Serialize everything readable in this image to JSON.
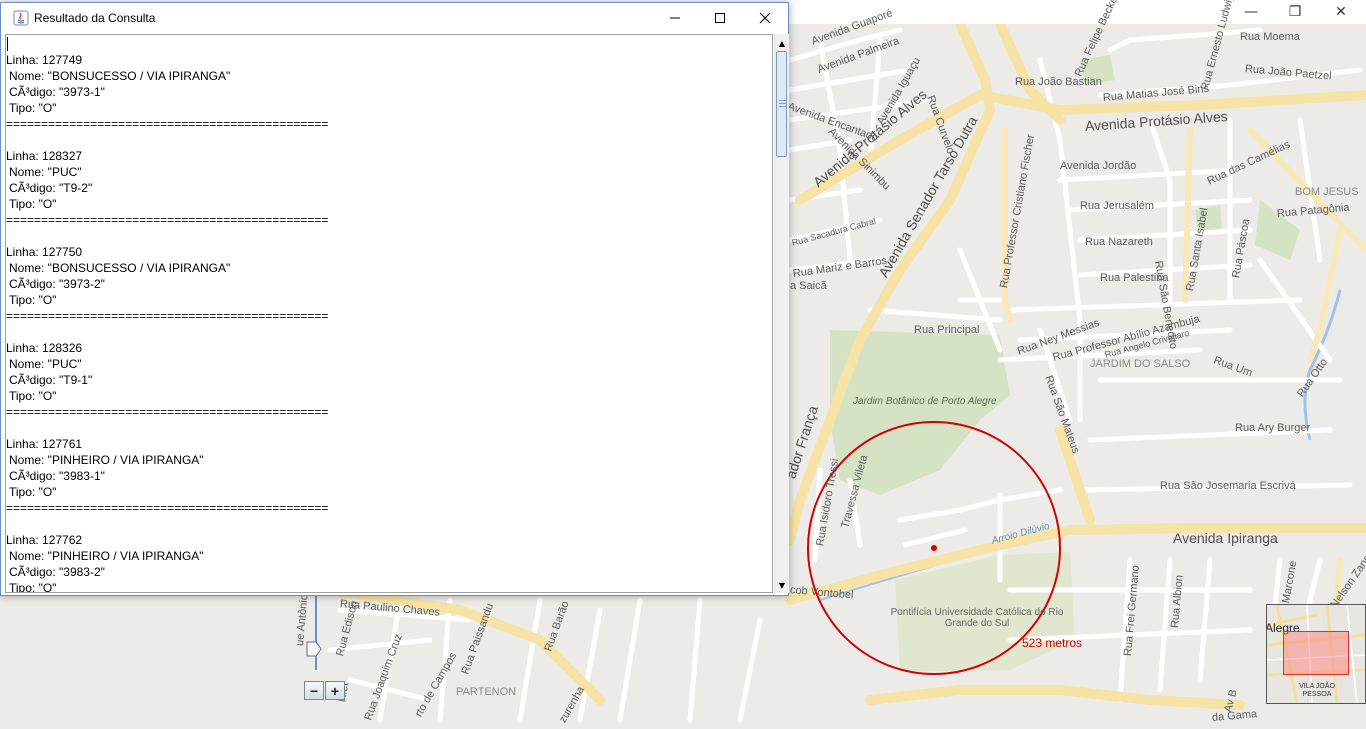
{
  "main_window": {
    "controls": {
      "minimize": "—",
      "restore": "❐",
      "close": "✕"
    }
  },
  "map": {
    "streets": [
      {
        "id": "av-guapore",
        "text": "Avenida Guaporé"
      },
      {
        "id": "av-palmeira",
        "text": "Avenida Palmeira"
      },
      {
        "id": "av-iguacu",
        "text": "Avenida Iguaçu"
      },
      {
        "id": "av-encantado",
        "text": "Avenida Encantado"
      },
      {
        "id": "av-sinimbu",
        "text": "Avenida Sinimbu"
      },
      {
        "id": "av-protasio-1",
        "text": "Avenida Protásio Alves"
      },
      {
        "id": "av-protasio-2",
        "text": "Avenida Protásio Alves"
      },
      {
        "id": "rua-curvelo",
        "text": "Rua Curvelo"
      },
      {
        "id": "av-tarso-dutra",
        "text": "Avenida Senador Tarso Dutra"
      },
      {
        "id": "rua-cristiano-fischer",
        "text": "Rua Professor Cristiano Fischer"
      },
      {
        "id": "rua-joao-bastian",
        "text": "Rua João Bastian"
      },
      {
        "id": "rua-felipe-becker",
        "text": "Rua Felipe Becker"
      },
      {
        "id": "rua-moema",
        "text": "Rua Moema"
      },
      {
        "id": "rua-joao-paetzel",
        "text": "Rua João Paetzel"
      },
      {
        "id": "rua-matias-jose-bins",
        "text": "Rua Matias José Bins"
      },
      {
        "id": "rua-ernesto-ludwig",
        "text": "Rua Ernesto Ludwig"
      },
      {
        "id": "av-jordao",
        "text": "Avenida Jordão"
      },
      {
        "id": "rua-das-camelias",
        "text": "Rua das Camélias"
      },
      {
        "id": "rua-jerusalem",
        "text": "Rua Jerusalém"
      },
      {
        "id": "rua-sao-benedito",
        "text": "Rua São Benedito"
      },
      {
        "id": "rua-santa-isabel",
        "text": "Rua Santa Isabel"
      },
      {
        "id": "bom-jesus",
        "text": "BOM JESUS"
      },
      {
        "id": "rua-patagonia",
        "text": "Rua Patagônia"
      },
      {
        "id": "rua-nazareth",
        "text": "Rua Nazareth"
      },
      {
        "id": "rua-pascoa",
        "text": "Rua Páscoa"
      },
      {
        "id": "rua-palestina",
        "text": "Rua Palestina"
      },
      {
        "id": "rua-sacadura-cabral",
        "text": "Rua Sacadura Cabral"
      },
      {
        "id": "rua-mariz-barros",
        "text": "Rua Mariz e Barros"
      },
      {
        "id": "rua-saica",
        "text": "a Saicã"
      },
      {
        "id": "rua-principal",
        "text": "Rua Principal"
      },
      {
        "id": "rua-ney-messias",
        "text": "Rua Ney Messias"
      },
      {
        "id": "rua-abilio-azambuja",
        "text": "Rua Professor Abílio Azambuja"
      },
      {
        "id": "rua-angelo-crivellaro",
        "text": "Rua Angelo Crivellaro"
      },
      {
        "id": "jardim-do-salso",
        "text": "JARDIM DO SALSO"
      },
      {
        "id": "rua-um",
        "text": "Rua Um"
      },
      {
        "id": "rua-sao-mateus",
        "text": "Rua São Mateus"
      },
      {
        "id": "jardim-botanico",
        "text": "Jardim Botânico de Porto Alegre"
      },
      {
        "id": "av-salvador-franca",
        "text": "ador França"
      },
      {
        "id": "rua-ary-burger",
        "text": "Rua Ary Burger"
      },
      {
        "id": "rua-otto",
        "text": "Rua Otto"
      },
      {
        "id": "rua-isidoro-tressi",
        "text": "Rua Isidoro Tressi"
      },
      {
        "id": "travessa-vileta",
        "text": "Travessa Vileta"
      },
      {
        "id": "rua-sao-josemaria",
        "text": "Rua São Josemaria Escrivá"
      },
      {
        "id": "arroio-diluvio",
        "text": "Arroio Dilúvio"
      },
      {
        "id": "av-ipiranga",
        "text": "Avenida Ipiranga"
      },
      {
        "id": "rua-jacob-vontobel",
        "text": "cob Vontobel"
      },
      {
        "id": "pucrs",
        "text": "Pontifícia Universidade Católica do Rio Grande do Sul"
      },
      {
        "id": "rua-frei-germano",
        "text": "Rua Frei Germano"
      },
      {
        "id": "rua-albion",
        "text": "Rua Albion"
      },
      {
        "id": "rua-marcone",
        "text": "Rua Marcone"
      },
      {
        "id": "rua-nelson-zang",
        "text": "Rua Nelson Zang"
      },
      {
        "id": "rua-paulino-chaves",
        "text": "Rua Paulino Chaves"
      },
      {
        "id": "rua-paissandu",
        "text": "Rua Paissandu"
      },
      {
        "id": "rua-barao",
        "text": "Rua Barão"
      },
      {
        "id": "rua-edison",
        "text": "Rua Edison"
      },
      {
        "id": "rua-antonio",
        "text": "ue Antônio"
      },
      {
        "id": "rua-joaquim-cruz",
        "text": "Rua Joaquim Cruz"
      },
      {
        "id": "rua-de-campos",
        "text": "rto de Campos"
      },
      {
        "id": "rua-riet",
        "text": "Riet"
      },
      {
        "id": "partenon",
        "text": "PARTENON"
      },
      {
        "id": "rua-zurenha",
        "text": "zurenha"
      },
      {
        "id": "rua-da-gama",
        "text": "da Gama"
      },
      {
        "id": "av-b",
        "text": "Av B"
      }
    ],
    "radius_label": "523 metros",
    "zoom": {
      "minus": "−",
      "plus": "+"
    },
    "minimap": {
      "label": "Alegre",
      "sublabel": "VILA JOÃO PESSOA"
    }
  },
  "dialog": {
    "title": "Resultado da Consulta",
    "controls": {
      "minimize": "—",
      "maximize": "☐",
      "close": "✕"
    },
    "separator": "==============================================",
    "records": [
      {
        "linha": "Linha: 127749",
        "nome": "Nome: \"BONSUCESSO / VIA IPIRANGA\"",
        "codigo": "CÃ³digo: \"3973-1\"",
        "tipo": "Tipo: \"O\""
      },
      {
        "linha": "Linha: 128327",
        "nome": "Nome: \"PUC\"",
        "codigo": "CÃ³digo: \"T9-2\"",
        "tipo": "Tipo: \"O\""
      },
      {
        "linha": "Linha: 127750",
        "nome": "Nome: \"BONSUCESSO / VIA IPIRANGA\"",
        "codigo": "CÃ³digo: \"3973-2\"",
        "tipo": "Tipo: \"O\""
      },
      {
        "linha": "Linha: 128326",
        "nome": "Nome: \"PUC\"",
        "codigo": "CÃ³digo: \"T9-1\"",
        "tipo": "Tipo: \"O\""
      },
      {
        "linha": "Linha: 127761",
        "nome": "Nome: \"PINHEIRO / VIA IPIRANGA\"",
        "codigo": "CÃ³digo: \"3983-1\"",
        "tipo": "Tipo: \"O\""
      },
      {
        "linha": "Linha: 127762",
        "nome": "Nome: \"PINHEIRO / VIA IPIRANGA\"",
        "codigo": "CÃ³digo: \"3983-2\"",
        "tipo": "Tipo: \"O\""
      }
    ],
    "scrollbar": {
      "up": "▲",
      "down": "▼"
    }
  },
  "colors": {
    "map_background": "#ecebe8",
    "road_major": "#f7e3a6",
    "park": "#d5e3c4",
    "circle": "#d40000",
    "water": "#9ec3e6"
  }
}
